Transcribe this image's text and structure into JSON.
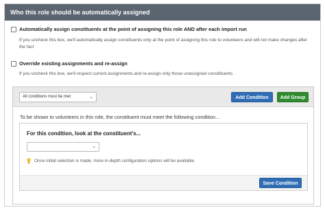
{
  "panel": {
    "title": "Who this role should be automatically assigned"
  },
  "options": [
    {
      "label": "Automatically assign constituents at the point of assigning this role AND after each import run",
      "help": "If you uncheck this box, we'll automatically assign constituents only at the point of assigning this role to volunteers and will not make changes after the fact",
      "checked": false
    },
    {
      "label": "Override existing assignments and re-assign",
      "help": "If you uncheck this box, we'll respect current assignments and re-assign only those unassigned consitituents",
      "checked": false
    }
  ],
  "rules": {
    "match_select": {
      "value": "All conditions must be met"
    },
    "add_condition_label": "Add Condition",
    "add_group_label": "Add Group",
    "intro": "To be shown to volunteers in this role, the constituent must meet the following condition...",
    "condition": {
      "title": "For this condition, look at the constituent's...",
      "field_select": {
        "value": ""
      },
      "hint": "Once initial selection is made, more in-depth configuration options will be available.",
      "save_label": "Save Condition"
    }
  },
  "colors": {
    "header_bg": "#5a6570",
    "primary_button": "#2f6db5",
    "success_button": "#2e8b2e",
    "hint_bulb": "#f2c230"
  },
  "icons": [
    "chevron-down-icon",
    "lightbulb-icon"
  ]
}
